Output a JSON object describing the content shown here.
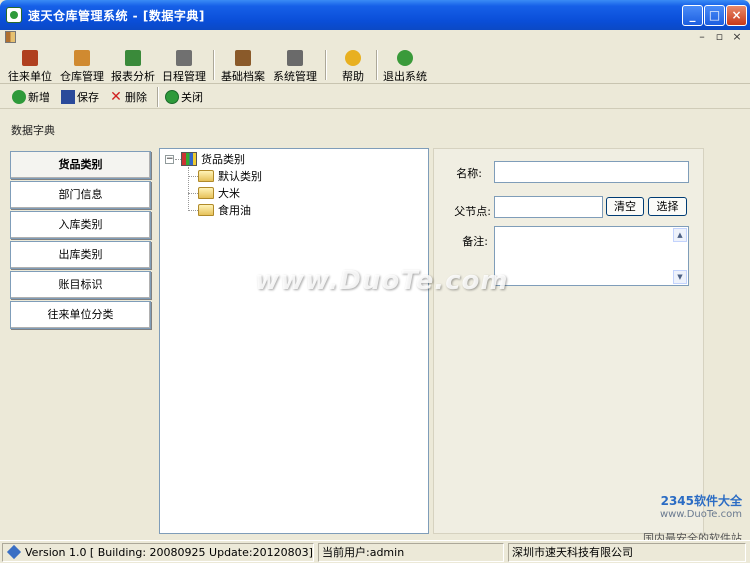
{
  "window": {
    "title": "速天仓库管理系统 - [数据字典]",
    "buttons": [
      "_",
      "□",
      "×"
    ]
  },
  "mdi": {
    "buttons": [
      "–",
      "▫",
      "×"
    ]
  },
  "toolbar": {
    "items": [
      {
        "label": "往来单位",
        "icon": "partner-icon",
        "color": "#b04020"
      },
      {
        "label": "仓库管理",
        "icon": "warehouse-icon",
        "color": "#d08a30"
      },
      {
        "label": "报表分析",
        "icon": "report-icon",
        "color": "#3a8a3a"
      },
      {
        "label": "日程管理",
        "icon": "calendar-icon",
        "color": "#707070"
      },
      {
        "label": "基础档案",
        "icon": "archive-icon",
        "color": "#8a5a2a"
      },
      {
        "label": "系统管理",
        "icon": "tools-icon",
        "color": "#6a6a6a"
      },
      {
        "label": "帮助",
        "icon": "help-icon",
        "color": "#e8b020"
      },
      {
        "label": "退出系统",
        "icon": "exit-icon",
        "color": "#3a9a3a"
      }
    ]
  },
  "actions": {
    "add": "新增",
    "save": "保存",
    "delete": "删除",
    "close": "关闭"
  },
  "section_label": "数据字典",
  "categories": [
    "货品类别",
    "部门信息",
    "入库类别",
    "出库类别",
    "账目标识",
    "往来单位分类"
  ],
  "tree": {
    "root": "货品类别",
    "children": [
      "默认类别",
      "大米",
      "食用油"
    ]
  },
  "form": {
    "name_label": "名称:",
    "parent_label": "父节点:",
    "note_label": "备注:",
    "clear_button": "清空",
    "select_button": "选择",
    "name_value": "",
    "parent_value": "",
    "note_value": ""
  },
  "status": {
    "version": "Version 1.0 [ Building: 20080925 Update:20120803]",
    "user": "当前用户:admin",
    "company": "深圳市速天科技有限公司"
  },
  "watermark": {
    "main": "www.DuoTe.com",
    "brand": "2345软件大全",
    "url": "www.DuoTe.com",
    "slogan": "国内最安全的软件站"
  }
}
